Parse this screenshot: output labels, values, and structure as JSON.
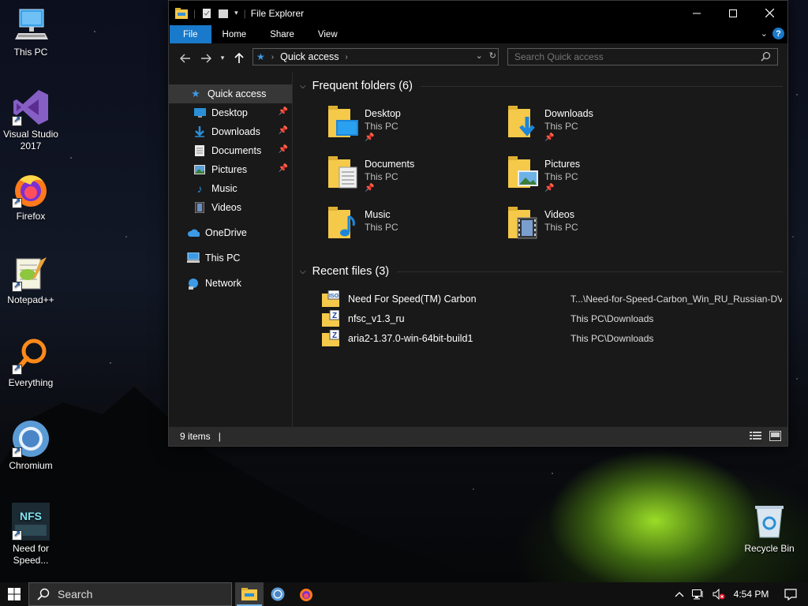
{
  "desktop": {
    "icons": [
      {
        "label": "This PC",
        "icon": "this-pc-icon"
      },
      {
        "label": "Visual Studio 2017",
        "icon": "visual-studio-icon"
      },
      {
        "label": "Firefox",
        "icon": "firefox-icon"
      },
      {
        "label": "Notepad++",
        "icon": "notepadpp-icon"
      },
      {
        "label": "Everything",
        "icon": "everything-search-icon"
      },
      {
        "label": "Chromium",
        "icon": "chromium-icon"
      },
      {
        "label": "Need for Speed...",
        "icon": "nfs-icon"
      },
      {
        "label": "Recycle Bin",
        "icon": "recycle-bin-icon"
      }
    ]
  },
  "explorer": {
    "title": "File Explorer",
    "ribbon_tabs": [
      "File",
      "Home",
      "Share",
      "View"
    ],
    "address": {
      "location": "Quick access"
    },
    "search": {
      "placeholder": "Search Quick access"
    },
    "nav_items": [
      {
        "label": "Quick access",
        "icon": "star-icon",
        "pinned": false,
        "selected": true
      },
      {
        "label": "Desktop",
        "icon": "desktop-icon",
        "pinned": true
      },
      {
        "label": "Downloads",
        "icon": "download-icon",
        "pinned": true
      },
      {
        "label": "Documents",
        "icon": "documents-icon",
        "pinned": true
      },
      {
        "label": "Pictures",
        "icon": "pictures-icon",
        "pinned": true
      },
      {
        "label": "Music",
        "icon": "music-icon",
        "pinned": false
      },
      {
        "label": "Videos",
        "icon": "videos-icon",
        "pinned": false
      },
      {
        "label": "OneDrive",
        "icon": "cloud-icon"
      },
      {
        "label": "This PC",
        "icon": "computer-icon"
      },
      {
        "label": "Network",
        "icon": "network-icon"
      }
    ],
    "frequent_header": "Frequent folders (6)",
    "frequent": [
      {
        "name": "Desktop",
        "location": "This PC",
        "pinned": true
      },
      {
        "name": "Downloads",
        "location": "This PC",
        "pinned": true
      },
      {
        "name": "Documents",
        "location": "This PC",
        "pinned": true
      },
      {
        "name": "Pictures",
        "location": "This PC",
        "pinned": true
      },
      {
        "name": "Music",
        "location": "This PC",
        "pinned": false
      },
      {
        "name": "Videos",
        "location": "This PC",
        "pinned": false
      }
    ],
    "recent_header": "Recent files (3)",
    "recent": [
      {
        "name": "Need For Speed(TM) Carbon",
        "path": "T...\\Need-for-Speed-Carbon_Win_RU_Russian-DVD",
        "type": "iso"
      },
      {
        "name": "nfsc_v1.3_ru",
        "path": "This PC\\Downloads",
        "type": "archive"
      },
      {
        "name": "aria2-1.37.0-win-64bit-build1",
        "path": "This PC\\Downloads",
        "type": "archive"
      }
    ],
    "status": {
      "items": "9 items"
    }
  },
  "taskbar": {
    "search_placeholder": "Search",
    "apps": [
      "file-explorer",
      "chromium",
      "firefox"
    ],
    "clock": "4:54 PM"
  },
  "colors": {
    "accent": "#1979ca",
    "window_bg": "#191919",
    "folder_yellow": "#f5c94a"
  }
}
